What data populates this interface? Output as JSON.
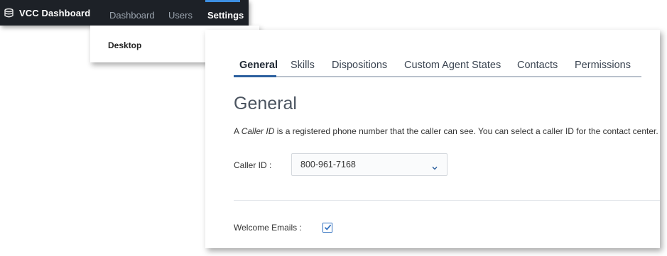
{
  "colors": {
    "nav_bg": "#1d2127",
    "nav_active_accent": "#3d8fe2",
    "tab_underline": "#2b5f9e",
    "checkbox_accent": "#2f6fbf"
  },
  "topnav": {
    "brand": {
      "icon": "database-stack-icon",
      "label": "VCC Dashboard"
    },
    "items": [
      {
        "label": "Dashboard",
        "active": false
      },
      {
        "label": "Users",
        "active": false
      },
      {
        "label": "Settings",
        "active": true
      }
    ]
  },
  "subnav": {
    "items": [
      {
        "label": "Desktop",
        "active": true
      }
    ]
  },
  "settings": {
    "tabs": [
      {
        "label": "General",
        "active": true
      },
      {
        "label": "Skills",
        "active": false
      },
      {
        "label": "Dispositions",
        "active": false
      },
      {
        "label": "Custom Agent States",
        "active": false
      },
      {
        "label": "Contacts",
        "active": false
      },
      {
        "label": "Permissions",
        "active": false
      }
    ],
    "heading": "General",
    "description": {
      "prefix": "A ",
      "emphasis": "Caller ID",
      "suffix": " is a registered phone number that the caller can see. You can select a caller ID for the contact center."
    },
    "caller_id": {
      "label": "Caller ID :",
      "selected": "800-961-7168",
      "icon": "chevron-down-icon"
    },
    "welcome_emails": {
      "label": "Welcome Emails :",
      "checked": true
    }
  }
}
